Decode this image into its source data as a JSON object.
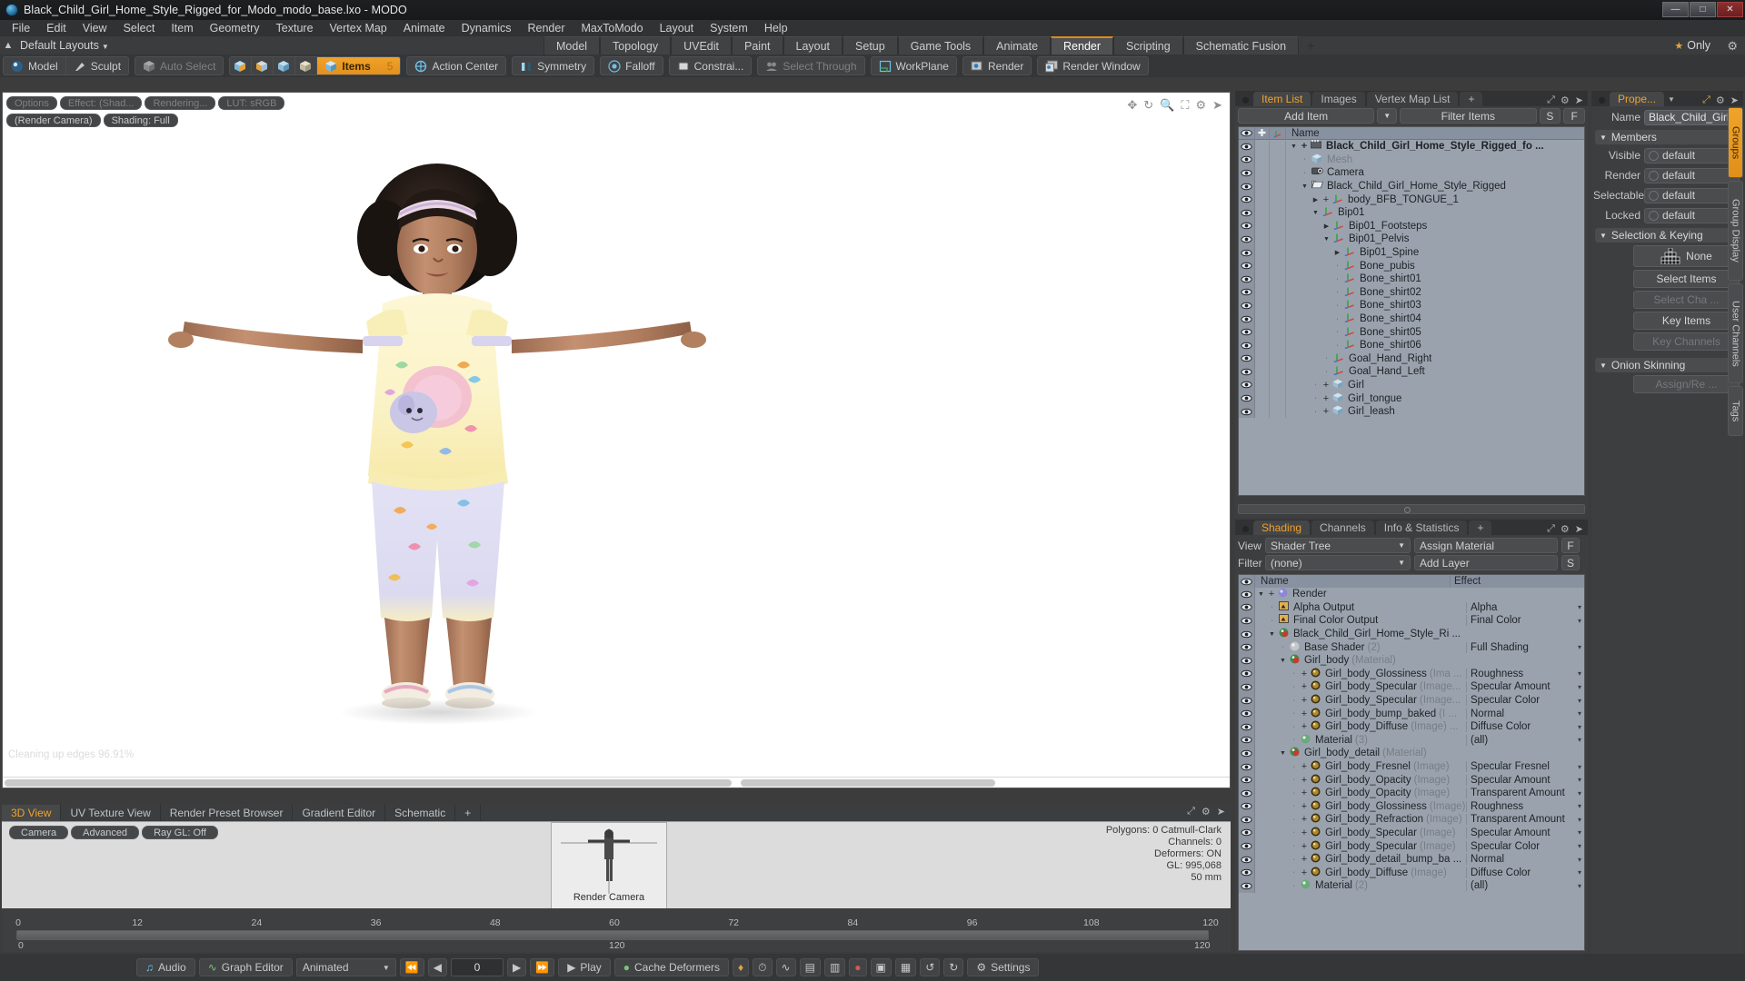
{
  "window": {
    "title": "Black_Child_Girl_Home_Style_Rigged_for_Modo_modo_base.lxo - MODO",
    "minimize": "—",
    "maximize": "□",
    "close": "✕"
  },
  "menu": [
    "File",
    "Edit",
    "View",
    "Select",
    "Item",
    "Geometry",
    "Texture",
    "Vertex Map",
    "Animate",
    "Dynamics",
    "Render",
    "MaxToModo",
    "Layout",
    "System",
    "Help"
  ],
  "layout_row": {
    "default_layouts": "Default Layouts",
    "tabs": [
      {
        "label": "Model",
        "active": false
      },
      {
        "label": "Topology",
        "active": false
      },
      {
        "label": "UVEdit",
        "active": false
      },
      {
        "label": "Paint",
        "active": false
      },
      {
        "label": "Layout",
        "active": false
      },
      {
        "label": "Setup",
        "active": false
      },
      {
        "label": "Game Tools",
        "active": false
      },
      {
        "label": "Animate",
        "active": false
      },
      {
        "label": "Render",
        "active": true
      },
      {
        "label": "Scripting",
        "active": false
      },
      {
        "label": "Schematic Fusion",
        "active": false
      },
      {
        "label": "+",
        "active": false
      }
    ],
    "only_label": "Only"
  },
  "toolbar": {
    "mode_buttons": [
      {
        "label": "Model",
        "icon": "sphere-icon",
        "state": "normal"
      },
      {
        "label": "Sculpt",
        "icon": "brush-icon",
        "state": "normal"
      }
    ],
    "select_buttons": [
      {
        "label": "Auto Select",
        "icon": "cube-icon",
        "state": "dim"
      }
    ],
    "component_icons": [
      "vertex-icon",
      "edge-icon",
      "polygon-icon",
      "material-icon"
    ],
    "items_button": {
      "label": "Items",
      "count": "5",
      "icon": "items-cube-icon"
    },
    "action_buttons": [
      {
        "label": "Action Center",
        "icon": "action-center-icon",
        "state": "normal"
      },
      {
        "label": "Symmetry",
        "icon": "symmetry-icon",
        "state": "normal"
      },
      {
        "label": "Falloff",
        "icon": "falloff-icon",
        "state": "normal"
      },
      {
        "label": "Constrai...",
        "icon": "constraint-icon",
        "state": "normal"
      },
      {
        "label": "Select Through",
        "icon": "select-through-icon",
        "state": "dim"
      },
      {
        "label": "WorkPlane",
        "icon": "workplane-icon",
        "state": "normal"
      },
      {
        "label": "Render",
        "icon": "render-icon",
        "state": "normal"
      },
      {
        "label": "Render Window",
        "icon": "render-window-icon",
        "state": "normal"
      }
    ]
  },
  "viewport": {
    "chips_row1": [
      {
        "label": "Options",
        "dim": true
      },
      {
        "label": "Effect: (Shad...",
        "dim": true
      },
      {
        "label": "Rendering...",
        "dim": true
      },
      {
        "label": "LUT: sRGB",
        "dim": true
      }
    ],
    "chips_row2": [
      {
        "label": "(Render Camera)",
        "dim": false
      },
      {
        "label": "Shading: Full",
        "dim": false
      }
    ],
    "nav_icons": [
      "pan-icon",
      "rotate-icon",
      "zoom-icon",
      "fit-icon",
      "gear-icon",
      "chevron-right-icon"
    ],
    "status_text": "Cleaning up edges 96.91%"
  },
  "bottom_tabs": {
    "tabs": [
      {
        "label": "3D View",
        "active": true
      },
      {
        "label": "UV Texture View",
        "active": false
      },
      {
        "label": "Render Preset Browser",
        "active": false
      },
      {
        "label": "Gradient Editor",
        "active": false
      },
      {
        "label": "Schematic",
        "active": false
      },
      {
        "label": "+",
        "active": false
      }
    ],
    "right_icons": [
      "expand-icon",
      "gear-icon",
      "chevron-right-icon"
    ]
  },
  "camera_panel": {
    "pills": [
      "Camera",
      "Advanced",
      "Ray GL: Off"
    ],
    "preview_label": "Render Camera",
    "stats": [
      "Polygons: 0 Catmull-Clark",
      "Channels: 0",
      "Deformers: ON",
      "GL: 995,068",
      "50 mm"
    ]
  },
  "timeline": {
    "ticks": [
      "0",
      "12",
      "24",
      "36",
      "48",
      "60",
      "72",
      "84",
      "96",
      "108",
      "120"
    ],
    "left_num": "0",
    "mid_num": "120",
    "right_num": "120",
    "start": "0",
    "end": "120"
  },
  "playbar": {
    "audio": "Audio",
    "graph_editor": "Graph Editor",
    "animated": "Animated",
    "frame_value": "0",
    "play": "Play",
    "cache_deformers": "Cache Deformers",
    "settings": "Settings",
    "transport_icons": [
      "skip-start-icon",
      "step-back-icon",
      "step-forward-icon",
      "skip-end-icon"
    ],
    "right_icons": [
      "key-icon",
      "clock-icon",
      "curve-icon",
      "range-icon",
      "range2-icon",
      "record-icon",
      "snap-icon",
      "snap2-icon",
      "loop-icon",
      "cycle-icon"
    ]
  },
  "item_list": {
    "tabs": [
      {
        "label": "Item List",
        "active": true
      },
      {
        "label": "Images",
        "active": false
      },
      {
        "label": "Vertex Map List",
        "active": false
      },
      {
        "label": "+",
        "active": false
      }
    ],
    "add_item": "Add Item",
    "filter_items": "Filter Items",
    "btn_s": "S",
    "btn_f": "F",
    "col_name": "Name",
    "rows": [
      {
        "name": "Black_Child_Girl_Home_Style_Rigged_fo ...",
        "indent": 0,
        "icon": "group-icon",
        "arrow": "down",
        "plus": true,
        "bold": true,
        "dim": false
      },
      {
        "name": "Mesh",
        "indent": 1,
        "icon": "mesh-icon",
        "arrow": "",
        "plus": false,
        "bold": false,
        "dim": true
      },
      {
        "name": "Camera",
        "indent": 1,
        "icon": "camera-icon",
        "arrow": "",
        "plus": false,
        "bold": false,
        "dim": false
      },
      {
        "name": "Black_Child_Girl_Home_Style_Rigged",
        "indent": 1,
        "icon": "folder-icon",
        "arrow": "down",
        "plus": false,
        "bold": false,
        "dim": false
      },
      {
        "name": "body_BFB_TONGUE_1",
        "indent": 2,
        "icon": "locator-icon",
        "arrow": "right",
        "plus": true,
        "bold": false,
        "dim": false
      },
      {
        "name": "Bip01",
        "indent": 2,
        "icon": "locator-icon",
        "arrow": "down",
        "plus": false,
        "bold": false,
        "dim": false
      },
      {
        "name": "Bip01_Footsteps",
        "indent": 3,
        "icon": "locator-icon",
        "arrow": "right",
        "plus": false,
        "bold": false,
        "dim": false
      },
      {
        "name": "Bip01_Pelvis",
        "indent": 3,
        "icon": "locator-icon",
        "arrow": "down",
        "plus": false,
        "bold": false,
        "dim": false
      },
      {
        "name": "Bip01_Spine",
        "indent": 4,
        "icon": "locator-icon",
        "arrow": "right",
        "plus": false,
        "bold": false,
        "dim": false
      },
      {
        "name": "Bone_pubis",
        "indent": 4,
        "icon": "locator-icon",
        "arrow": "",
        "plus": false,
        "bold": false,
        "dim": false
      },
      {
        "name": "Bone_shirt01",
        "indent": 4,
        "icon": "locator-icon",
        "arrow": "",
        "plus": false,
        "bold": false,
        "dim": false
      },
      {
        "name": "Bone_shirt02",
        "indent": 4,
        "icon": "locator-icon",
        "arrow": "",
        "plus": false,
        "bold": false,
        "dim": false
      },
      {
        "name": "Bone_shirt03",
        "indent": 4,
        "icon": "locator-icon",
        "arrow": "",
        "plus": false,
        "bold": false,
        "dim": false
      },
      {
        "name": "Bone_shirt04",
        "indent": 4,
        "icon": "locator-icon",
        "arrow": "",
        "plus": false,
        "bold": false,
        "dim": false
      },
      {
        "name": "Bone_shirt05",
        "indent": 4,
        "icon": "locator-icon",
        "arrow": "",
        "plus": false,
        "bold": false,
        "dim": false
      },
      {
        "name": "Bone_shirt06",
        "indent": 4,
        "icon": "locator-icon",
        "arrow": "",
        "plus": false,
        "bold": false,
        "dim": false
      },
      {
        "name": "Goal_Hand_Right",
        "indent": 3,
        "icon": "locator-icon",
        "arrow": "",
        "plus": false,
        "bold": false,
        "dim": false
      },
      {
        "name": "Goal_Hand_Left",
        "indent": 3,
        "icon": "locator-icon",
        "arrow": "",
        "plus": false,
        "bold": false,
        "dim": false
      },
      {
        "name": "Girl",
        "indent": 2,
        "icon": "mesh-icon",
        "arrow": "",
        "plus": true,
        "bold": false,
        "dim": false
      },
      {
        "name": "Girl_tongue",
        "indent": 2,
        "icon": "mesh-icon",
        "arrow": "",
        "plus": true,
        "bold": false,
        "dim": false
      },
      {
        "name": "Girl_leash",
        "indent": 2,
        "icon": "mesh-icon",
        "arrow": "",
        "plus": true,
        "bold": false,
        "dim": false
      }
    ]
  },
  "shading": {
    "tabs": [
      {
        "label": "Shading",
        "active": true
      },
      {
        "label": "Channels",
        "active": false
      },
      {
        "label": "Info & Statistics",
        "active": false
      },
      {
        "label": "+",
        "active": false
      }
    ],
    "view_label": "View",
    "view_value": "Shader Tree",
    "assign_material": "Assign Material",
    "btn_f": "F",
    "filter_label": "Filter",
    "filter_value": "(none)",
    "add_layer": "Add Layer",
    "btn_s": "S",
    "col_name": "Name",
    "col_effect": "Effect",
    "rows": [
      {
        "name": "Render",
        "suffix": "",
        "effect": "",
        "indent": 0,
        "icon": "render-globe-icon",
        "arrow": "down",
        "plus": true
      },
      {
        "name": "Alpha Output",
        "suffix": "",
        "effect": "Alpha",
        "indent": 1,
        "icon": "output-icon",
        "arrow": "",
        "plus": false
      },
      {
        "name": "Final Color Output",
        "suffix": "",
        "effect": "Final Color",
        "indent": 1,
        "icon": "output-icon",
        "arrow": "",
        "plus": false
      },
      {
        "name": "Black_Child_Girl_Home_Style_Ri ...",
        "suffix": "",
        "effect": "",
        "indent": 1,
        "icon": "material-ball-icon",
        "arrow": "down",
        "plus": false
      },
      {
        "name": "Base Shader",
        "suffix": "(2)",
        "effect": "Full Shading",
        "indent": 2,
        "icon": "shader-icon",
        "arrow": "",
        "plus": false
      },
      {
        "name": "Girl_body",
        "suffix": "(Material)",
        "effect": "",
        "indent": 2,
        "icon": "material-ball-icon",
        "arrow": "down",
        "plus": false
      },
      {
        "name": "Girl_body_Glossiness",
        "suffix": "(Ima ...",
        "effect": "Roughness",
        "indent": 3,
        "icon": "image-icon",
        "arrow": "",
        "plus": true
      },
      {
        "name": "Girl_body_Specular",
        "suffix": "(Image...",
        "effect": "Specular Amount",
        "indent": 3,
        "icon": "image-icon",
        "arrow": "",
        "plus": true
      },
      {
        "name": "Girl_body_Specular",
        "suffix": "(Image...",
        "effect": "Specular Color",
        "indent": 3,
        "icon": "image-icon",
        "arrow": "",
        "plus": true
      },
      {
        "name": "Girl_body_bump_baked",
        "suffix": "(I ...",
        "effect": "Normal",
        "indent": 3,
        "icon": "image-icon",
        "arrow": "",
        "plus": true
      },
      {
        "name": "Girl_body_Diffuse",
        "suffix": "(Image) ...",
        "effect": "Diffuse Color",
        "indent": 3,
        "icon": "image-icon",
        "arrow": "",
        "plus": true
      },
      {
        "name": "Material",
        "suffix": "(3)",
        "effect": "(all)",
        "indent": 3,
        "icon": "green-ball-icon",
        "arrow": "",
        "plus": false
      },
      {
        "name": "Girl_body_detail",
        "suffix": "(Material)",
        "effect": "",
        "indent": 2,
        "icon": "material-ball-icon",
        "arrow": "down",
        "plus": false
      },
      {
        "name": "Girl_body_Fresnel",
        "suffix": "(Image)",
        "effect": "Specular Fresnel",
        "indent": 3,
        "icon": "image-icon",
        "arrow": "",
        "plus": true
      },
      {
        "name": "Girl_body_Opacity",
        "suffix": "(Image)",
        "effect": "Specular Amount",
        "indent": 3,
        "icon": "image-icon",
        "arrow": "",
        "plus": true
      },
      {
        "name": "Girl_body_Opacity",
        "suffix": "(Image)",
        "effect": "Transparent Amount",
        "indent": 3,
        "icon": "image-icon",
        "arrow": "",
        "plus": true
      },
      {
        "name": "Girl_body_Glossiness",
        "suffix": "(Image)",
        "effect": "Roughness",
        "indent": 3,
        "icon": "image-icon",
        "arrow": "",
        "plus": true
      },
      {
        "name": "Girl_body_Refraction",
        "suffix": "(Image)",
        "effect": "Transparent Amount",
        "indent": 3,
        "icon": "image-icon",
        "arrow": "",
        "plus": true
      },
      {
        "name": "Girl_body_Specular",
        "suffix": "(Image)",
        "effect": "Specular Amount",
        "indent": 3,
        "icon": "image-icon",
        "arrow": "",
        "plus": true
      },
      {
        "name": "Girl_body_Specular",
        "suffix": "(Image)",
        "effect": "Specular Color",
        "indent": 3,
        "icon": "image-icon",
        "arrow": "",
        "plus": true
      },
      {
        "name": "Girl_body_detail_bump_ba ...",
        "suffix": "",
        "effect": "Normal",
        "indent": 3,
        "icon": "image-icon",
        "arrow": "",
        "plus": true
      },
      {
        "name": "Girl_body_Diffuse",
        "suffix": "(Image)",
        "effect": "Diffuse Color",
        "indent": 3,
        "icon": "image-icon",
        "arrow": "",
        "plus": true
      },
      {
        "name": "Material",
        "suffix": "(2)",
        "effect": "(all)",
        "indent": 3,
        "icon": "green-ball-icon",
        "arrow": "",
        "plus": false
      }
    ]
  },
  "properties": {
    "tab_label": "Prope...",
    "name_label": "Name",
    "name_value": "Black_Child_Girl_",
    "members_label": "Members",
    "fields": [
      {
        "label": "Visible",
        "value": "default"
      },
      {
        "label": "Render",
        "value": "default"
      },
      {
        "label": "Selectable",
        "value": "default"
      },
      {
        "label": "Locked",
        "value": "default"
      }
    ],
    "selection_keying_label": "Selection & Keying",
    "none_label": "None",
    "select_items": "Select Items",
    "select_channels": "Select Cha ...",
    "key_items": "Key Items",
    "key_channels": "Key Channels",
    "onion_label": "Onion Skinning",
    "assign_remove": "Assign/Re ...",
    "side_tabs": [
      {
        "label": "Groups",
        "active": true
      },
      {
        "label": "Group Display",
        "active": false
      },
      {
        "label": "User Channels",
        "active": false
      },
      {
        "label": "Tags",
        "active": false
      }
    ]
  },
  "colors": {
    "accent": "#f0a22c",
    "panel_bg": "#3c3e40",
    "tree_bg": "#9aa3ad",
    "viewport_bg": "#ffffff"
  }
}
